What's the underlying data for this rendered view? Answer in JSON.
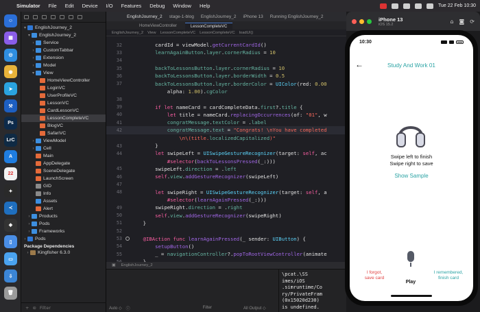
{
  "menubar": {
    "app": "Simulator",
    "items": [
      "File",
      "Edit",
      "Device",
      "I/O",
      "Features",
      "Debug",
      "Window",
      "Help"
    ],
    "datetime": "Tue 22 Feb  10:30"
  },
  "dock": {
    "apps": [
      {
        "name": "finder",
        "color": "#2b6fd8",
        "glyph": "☺"
      },
      {
        "name": "launchpad",
        "color": "#8a5de8",
        "glyph": "▦"
      },
      {
        "name": "safari",
        "color": "#2f8ee0",
        "glyph": "◎"
      },
      {
        "name": "chrome",
        "color": "#e9b33a",
        "glyph": "◉"
      },
      {
        "name": "telegram",
        "color": "#2aa3e0",
        "glyph": "➤"
      },
      {
        "name": "xcode",
        "color": "#1d5fc2",
        "glyph": "⚒"
      },
      {
        "name": "photoshop",
        "color": "#0d2a4a",
        "glyph": "Ps"
      },
      {
        "name": "lightroom",
        "color": "#0f2a44",
        "glyph": "LrC"
      },
      {
        "name": "app-store",
        "color": "#1f7de0",
        "glyph": "A"
      },
      {
        "name": "calendar",
        "color": "#f3f3f3",
        "glyph": "22"
      },
      {
        "name": "figma",
        "color": "#2a2a2a",
        "glyph": "✦"
      },
      {
        "name": "vscode",
        "color": "#1f6fbf",
        "glyph": "≺"
      },
      {
        "name": "davinci",
        "color": "#333",
        "glyph": "◈"
      },
      {
        "name": "simulator",
        "color": "#4a8ee6",
        "glyph": "▯"
      },
      {
        "name": "folder",
        "color": "#4aa3f0",
        "glyph": "▭"
      },
      {
        "name": "downloads",
        "color": "#3b85d6",
        "glyph": "⇩"
      },
      {
        "name": "trash",
        "color": "#9b9b9b",
        "glyph": "🗑"
      }
    ]
  },
  "navigator": {
    "items": [
      {
        "label": "EnglishJourney_2",
        "depth": 0,
        "icon": "proj",
        "chev": "▾"
      },
      {
        "label": "EnglishJourney_2",
        "depth": 1,
        "icon": "folder",
        "chev": "▾"
      },
      {
        "label": "Service",
        "depth": 2,
        "icon": "folder",
        "chev": "›"
      },
      {
        "label": "CustomTabbar",
        "depth": 2,
        "icon": "folder",
        "chev": "›"
      },
      {
        "label": "Extension",
        "depth": 2,
        "icon": "folder",
        "chev": "›"
      },
      {
        "label": "Model",
        "depth": 2,
        "icon": "folder",
        "chev": "›"
      },
      {
        "label": "View",
        "depth": 2,
        "icon": "folder",
        "chev": "▾"
      },
      {
        "label": "HomeViewController",
        "depth": 3,
        "icon": "swift",
        "chev": ""
      },
      {
        "label": "LoginVC",
        "depth": 3,
        "icon": "swift",
        "chev": ""
      },
      {
        "label": "UserProfileVC",
        "depth": 3,
        "icon": "swift",
        "chev": ""
      },
      {
        "label": "LessonVC",
        "depth": 3,
        "icon": "swift",
        "chev": ""
      },
      {
        "label": "CardLessonVC",
        "depth": 3,
        "icon": "swift",
        "chev": ""
      },
      {
        "label": "LessonCompleteVC",
        "depth": 3,
        "icon": "swift",
        "chev": "",
        "selected": true
      },
      {
        "label": "BlogVC",
        "depth": 3,
        "icon": "swift",
        "chev": ""
      },
      {
        "label": "SafariVC",
        "depth": 3,
        "icon": "swift",
        "chev": ""
      },
      {
        "label": "ViewModel",
        "depth": 2,
        "icon": "folder",
        "chev": "›"
      },
      {
        "label": "Cell",
        "depth": 2,
        "icon": "folder",
        "chev": "›"
      },
      {
        "label": "Main",
        "depth": 2,
        "icon": "swift",
        "chev": ""
      },
      {
        "label": "AppDelegate",
        "depth": 2,
        "icon": "swift",
        "chev": ""
      },
      {
        "label": "SceneDelegate",
        "depth": 2,
        "icon": "swift",
        "chev": ""
      },
      {
        "label": "LaunchScreen",
        "depth": 2,
        "icon": "swift",
        "chev": ""
      },
      {
        "label": "GID",
        "depth": 2,
        "icon": "asset",
        "chev": ""
      },
      {
        "label": "Info",
        "depth": 2,
        "icon": "asset",
        "chev": ""
      },
      {
        "label": "Assets",
        "depth": 2,
        "icon": "folder",
        "chev": ""
      },
      {
        "label": "Alert",
        "depth": 2,
        "icon": "swift",
        "chev": ""
      },
      {
        "label": "Products",
        "depth": 1,
        "icon": "folder",
        "chev": "›"
      },
      {
        "label": "Pods",
        "depth": 1,
        "icon": "folder",
        "chev": "›"
      },
      {
        "label": "Frameworks",
        "depth": 1,
        "icon": "folder",
        "chev": "›"
      },
      {
        "label": "Pods",
        "depth": 0,
        "icon": "proj",
        "chev": "›"
      }
    ],
    "packages_header": "Package Dependencies",
    "package": "Kingfisher 6.3.0",
    "filter_placeholder": "Filter"
  },
  "editor": {
    "toolbar_title": "EnglishJourney_2",
    "toolbar_sub": "stage-1-blog",
    "scheme": "EnglishJourney_2",
    "device": "iPhone 13",
    "status": "Running EnglishJourney_2",
    "tabs": [
      "HomeViewController",
      "LessonCompleteVC"
    ],
    "jumpbar": [
      "EnglishJourney_2",
      "View",
      "LessonCompleteVC",
      "LessonCompleteVC",
      "loadUI()"
    ],
    "bottombar": [
      "EnglishJourney_2"
    ],
    "debug_left": "Auto ◇",
    "debug_right": "All Output ◇",
    "filter": "Filter",
    "console_lines": [
      "\\pcat.\\SS",
      "imes/iOS",
      ".simruntime/Co",
      "ry/PrivateFram",
      "(0x15020d230)",
      "is undefined."
    ]
  },
  "code": {
    "lines": [
      {
        "n": "32",
        "tokens": [
          [
            "txt",
            "        cardId = viewModel."
          ],
          [
            "fn",
            "getCurrentCardId"
          ],
          [
            "txt",
            "()"
          ]
        ]
      },
      {
        "n": "33",
        "tokens": [
          [
            "txt",
            "        "
          ],
          [
            "prop",
            "learnAgainButton"
          ],
          [
            "txt",
            "."
          ],
          [
            "prop",
            "layer"
          ],
          [
            "txt",
            "."
          ],
          [
            "prop",
            "cornerRadius"
          ],
          [
            "txt",
            " = "
          ],
          [
            "num",
            "10"
          ]
        ]
      },
      {
        "n": "34",
        "tokens": [
          [
            "txt",
            ""
          ]
        ]
      },
      {
        "n": "35",
        "tokens": [
          [
            "txt",
            "        "
          ],
          [
            "prop",
            "backToLessonsButton"
          ],
          [
            "txt",
            "."
          ],
          [
            "prop",
            "layer"
          ],
          [
            "txt",
            "."
          ],
          [
            "prop",
            "cornerRadius"
          ],
          [
            "txt",
            " = "
          ],
          [
            "num",
            "10"
          ]
        ]
      },
      {
        "n": "36",
        "tokens": [
          [
            "txt",
            "        "
          ],
          [
            "prop",
            "backToLessonsButton"
          ],
          [
            "txt",
            "."
          ],
          [
            "prop",
            "layer"
          ],
          [
            "txt",
            "."
          ],
          [
            "prop",
            "borderWidth"
          ],
          [
            "txt",
            " = "
          ],
          [
            "num",
            "0.5"
          ]
        ]
      },
      {
        "n": "37",
        "tokens": [
          [
            "txt",
            "        "
          ],
          [
            "prop",
            "backToLessonsButton"
          ],
          [
            "txt",
            "."
          ],
          [
            "prop",
            "layer"
          ],
          [
            "txt",
            "."
          ],
          [
            "prop",
            "borderColor"
          ],
          [
            "txt",
            " = "
          ],
          [
            "ty",
            "UIColor"
          ],
          [
            "txt",
            "(red: "
          ],
          [
            "num",
            "0.00"
          ]
        ]
      },
      {
        "n": "",
        "tokens": [
          [
            "txt",
            "            alpha: "
          ],
          [
            "num",
            "1.00"
          ],
          [
            "txt",
            ")."
          ],
          [
            "prop",
            "cgColor"
          ]
        ]
      },
      {
        "n": "38",
        "tokens": [
          [
            "txt",
            ""
          ]
        ]
      },
      {
        "n": "39",
        "tokens": [
          [
            "txt",
            "        "
          ],
          [
            "kw",
            "if let"
          ],
          [
            "txt",
            " nameCard = cardCompleteData."
          ],
          [
            "prop",
            "first"
          ],
          [
            "txt",
            "?."
          ],
          [
            "prop",
            "title"
          ],
          [
            "txt",
            " {"
          ]
        ]
      },
      {
        "n": "40",
        "tokens": [
          [
            "txt",
            "            "
          ],
          [
            "kw",
            "let"
          ],
          [
            "txt",
            " title = nameCard."
          ],
          [
            "fn",
            "replacingOccurrences"
          ],
          [
            "txt",
            "(of: "
          ],
          [
            "str",
            "\"01\""
          ],
          [
            "txt",
            ", w"
          ]
        ]
      },
      {
        "n": "41",
        "tokens": [
          [
            "txt",
            "            "
          ],
          [
            "prop",
            "congratMessage"
          ],
          [
            "txt",
            "."
          ],
          [
            "prop",
            "textColor"
          ],
          [
            "txt",
            " = ."
          ],
          [
            "prop",
            "label"
          ]
        ]
      },
      {
        "n": "42",
        "cur": true,
        "tokens": [
          [
            "txt",
            "            "
          ],
          [
            "prop",
            "congratMessage"
          ],
          [
            "txt",
            "."
          ],
          [
            "prop",
            "text"
          ],
          [
            "txt",
            " = "
          ],
          [
            "str",
            "\"Congrats! \\nYou have completed"
          ]
        ]
      },
      {
        "n": "",
        "tokens": [
          [
            "str",
            "                \\n\\(title."
          ],
          [
            "prop",
            "localizedCapitalized"
          ],
          [
            "str",
            ")\""
          ]
        ]
      },
      {
        "n": "43",
        "tokens": [
          [
            "txt",
            "        }"
          ]
        ]
      },
      {
        "n": "44",
        "tokens": [
          [
            "txt",
            "        "
          ],
          [
            "kw",
            "let"
          ],
          [
            "txt",
            " swipeLeft = "
          ],
          [
            "ty",
            "UISwipeGestureRecognizer"
          ],
          [
            "txt",
            "(target: "
          ],
          [
            "kw",
            "self"
          ],
          [
            "txt",
            ", ac"
          ]
        ]
      },
      {
        "n": "",
        "tokens": [
          [
            "txt",
            "            "
          ],
          [
            "kw",
            "#selector"
          ],
          [
            "txt",
            "("
          ],
          [
            "fn",
            "backToLessonsPressed"
          ],
          [
            "txt",
            "(_:)))"
          ]
        ]
      },
      {
        "n": "45",
        "tokens": [
          [
            "txt",
            "        swipeLeft."
          ],
          [
            "prop",
            "direction"
          ],
          [
            "txt",
            " = ."
          ],
          [
            "prop",
            "left"
          ]
        ]
      },
      {
        "n": "46",
        "tokens": [
          [
            "txt",
            "        "
          ],
          [
            "kw",
            "self"
          ],
          [
            "txt",
            "."
          ],
          [
            "prop",
            "view"
          ],
          [
            "txt",
            "."
          ],
          [
            "fn",
            "addGestureRecognizer"
          ],
          [
            "txt",
            "(swipeLeft)"
          ]
        ]
      },
      {
        "n": "47",
        "tokens": [
          [
            "txt",
            ""
          ]
        ]
      },
      {
        "n": "48",
        "tokens": [
          [
            "txt",
            "        "
          ],
          [
            "kw",
            "let"
          ],
          [
            "txt",
            " swipeRight = "
          ],
          [
            "ty",
            "UISwipeGestureRecognizer"
          ],
          [
            "txt",
            "(target: "
          ],
          [
            "kw",
            "self"
          ],
          [
            "txt",
            ", a"
          ]
        ]
      },
      {
        "n": "",
        "tokens": [
          [
            "txt",
            "            "
          ],
          [
            "kw",
            "#selector"
          ],
          [
            "txt",
            "("
          ],
          [
            "fn",
            "learnAgainPressed"
          ],
          [
            "txt",
            "(_:)))"
          ]
        ]
      },
      {
        "n": "49",
        "tokens": [
          [
            "txt",
            "        swipeRight."
          ],
          [
            "prop",
            "direction"
          ],
          [
            "txt",
            " = ."
          ],
          [
            "prop",
            "right"
          ]
        ]
      },
      {
        "n": "50",
        "tokens": [
          [
            "txt",
            "        "
          ],
          [
            "kw",
            "self"
          ],
          [
            "txt",
            "."
          ],
          [
            "prop",
            "view"
          ],
          [
            "txt",
            "."
          ],
          [
            "fn",
            "addGestureRecognizer"
          ],
          [
            "txt",
            "(swipeRight)"
          ]
        ]
      },
      {
        "n": "51",
        "tokens": [
          [
            "txt",
            "    }"
          ]
        ]
      },
      {
        "n": "52",
        "tokens": [
          [
            "txt",
            ""
          ]
        ]
      },
      {
        "n": "53",
        "gutter": true,
        "tokens": [
          [
            "txt",
            "    "
          ],
          [
            "kw",
            "@IBAction func"
          ],
          [
            "txt",
            " "
          ],
          [
            "fn",
            "learnAgainPressed"
          ],
          [
            "txt",
            "(_ sender: "
          ],
          [
            "ty",
            "UIButton"
          ],
          [
            "txt",
            ") {"
          ]
        ]
      },
      {
        "n": "54",
        "tokens": [
          [
            "txt",
            "        "
          ],
          [
            "fn",
            "setupButton"
          ],
          [
            "txt",
            "()"
          ]
        ]
      },
      {
        "n": "55",
        "tokens": [
          [
            "txt",
            "        _ = "
          ],
          [
            "prop",
            "navigationController"
          ],
          [
            "txt",
            "?."
          ],
          [
            "fn",
            "popToRootViewController"
          ],
          [
            "txt",
            "(animate"
          ]
        ]
      },
      {
        "n": "56",
        "tokens": [
          [
            "txt",
            "    }"
          ]
        ]
      }
    ]
  },
  "simulator": {
    "title": "iPhone 13",
    "subtitle": "iOS 15.2",
    "time": "10:30",
    "nav_title": "Study And Work 01",
    "message_line1": "Swipe left to finish",
    "message_line2": "Swipe right to save",
    "show_sample": "Show Sample",
    "forgot_line1": "I forgot,",
    "forgot_line2": "save card",
    "play": "Play",
    "remembered_line1": "I remembered,",
    "remembered_line2": "finish card",
    "accent": "#2aa3a4",
    "danger": "#e03e3e"
  }
}
